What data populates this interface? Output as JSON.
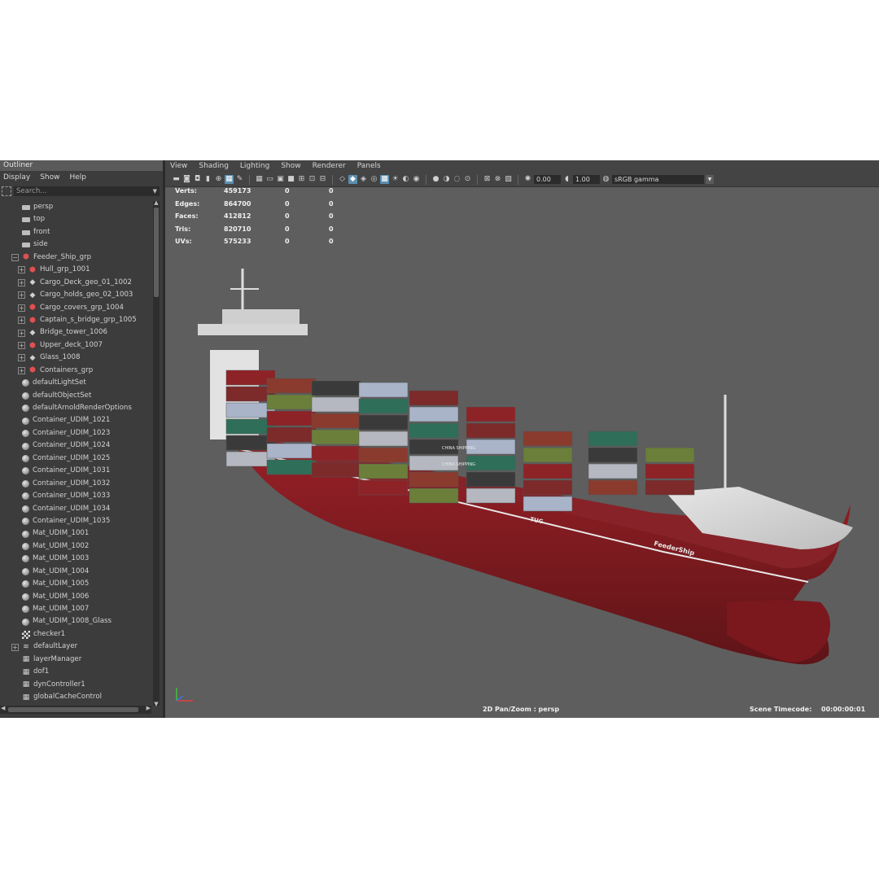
{
  "outliner": {
    "title": "Outliner",
    "menu": [
      "Display",
      "Show",
      "Help"
    ],
    "search_placeholder": "Search...",
    "items": [
      {
        "label": "persp",
        "icon": "camera-icon",
        "expand": false,
        "indent": 1
      },
      {
        "label": "top",
        "icon": "camera-icon",
        "expand": false,
        "indent": 1
      },
      {
        "label": "front",
        "icon": "camera-icon",
        "expand": false,
        "indent": 1
      },
      {
        "label": "side",
        "icon": "camera-icon",
        "expand": false,
        "indent": 1
      },
      {
        "label": "Feeder_Ship_grp",
        "icon": "group-icon",
        "expand": "minus",
        "indent": 0
      },
      {
        "label": "Hull_grp_1001",
        "icon": "group-icon",
        "expand": "plus",
        "indent": 1
      },
      {
        "label": "Cargo_Deck_geo_01_1002",
        "icon": "mesh-icon",
        "expand": "plus",
        "indent": 1
      },
      {
        "label": "Cargo_holds_geo_02_1003",
        "icon": "mesh-icon",
        "expand": "plus",
        "indent": 1
      },
      {
        "label": "Cargo_covers_grp_1004",
        "icon": "group-icon",
        "expand": "plus",
        "indent": 1
      },
      {
        "label": "Captain_s_bridge_grp_1005",
        "icon": "group-icon",
        "expand": "plus",
        "indent": 1
      },
      {
        "label": "Bridge_tower_1006",
        "icon": "mesh-icon",
        "expand": "plus",
        "indent": 1
      },
      {
        "label": "Upper_deck_1007",
        "icon": "group-icon",
        "expand": "plus",
        "indent": 1
      },
      {
        "label": "Glass_1008",
        "icon": "mesh-icon",
        "expand": "plus",
        "indent": 1
      },
      {
        "label": "Containers_grp",
        "icon": "group-icon",
        "expand": "plus",
        "indent": 1
      },
      {
        "label": "defaultLightSet",
        "icon": "set-icon",
        "expand": false,
        "indent": 0
      },
      {
        "label": "defaultObjectSet",
        "icon": "set-icon",
        "expand": false,
        "indent": 0
      },
      {
        "label": "defaultArnoldRenderOptions",
        "icon": "material-ball-icon",
        "expand": false,
        "indent": 0
      },
      {
        "label": "Container_UDIM_1021",
        "icon": "material-ball-icon",
        "expand": false,
        "indent": 0
      },
      {
        "label": "Container_UDIM_1023",
        "icon": "material-ball-icon",
        "expand": false,
        "indent": 0
      },
      {
        "label": "Container_UDIM_1024",
        "icon": "material-ball-icon",
        "expand": false,
        "indent": 0
      },
      {
        "label": "Container_UDIM_1025",
        "icon": "material-ball-icon",
        "expand": false,
        "indent": 0
      },
      {
        "label": "Container_UDIM_1031",
        "icon": "material-ball-icon",
        "expand": false,
        "indent": 0
      },
      {
        "label": "Container_UDIM_1032",
        "icon": "material-ball-icon",
        "expand": false,
        "indent": 0
      },
      {
        "label": "Container_UDIM_1033",
        "icon": "material-ball-icon",
        "expand": false,
        "indent": 0
      },
      {
        "label": "Container_UDIM_1034",
        "icon": "material-ball-icon",
        "expand": false,
        "indent": 0
      },
      {
        "label": "Container_UDIM_1035",
        "icon": "material-ball-icon",
        "expand": false,
        "indent": 0
      },
      {
        "label": "Mat_UDIM_1001",
        "icon": "material-ball-icon",
        "expand": false,
        "indent": 0
      },
      {
        "label": "Mat_UDIM_1002",
        "icon": "material-ball-icon",
        "expand": false,
        "indent": 0
      },
      {
        "label": "Mat_UDIM_1003",
        "icon": "material-ball-icon",
        "expand": false,
        "indent": 0
      },
      {
        "label": "Mat_UDIM_1004",
        "icon": "material-ball-icon",
        "expand": false,
        "indent": 0
      },
      {
        "label": "Mat_UDIM_1005",
        "icon": "material-ball-icon",
        "expand": false,
        "indent": 0
      },
      {
        "label": "Mat_UDIM_1006",
        "icon": "material-ball-icon",
        "expand": false,
        "indent": 0
      },
      {
        "label": "Mat_UDIM_1007",
        "icon": "material-ball-icon",
        "expand": false,
        "indent": 0
      },
      {
        "label": "Mat_UDIM_1008_Glass",
        "icon": "material-ball-icon",
        "expand": false,
        "indent": 0
      },
      {
        "label": "checker1",
        "icon": "checker-icon",
        "expand": false,
        "indent": 0
      },
      {
        "label": "defaultLayer",
        "icon": "layer-icon",
        "expand": "plus",
        "indent": 0
      },
      {
        "label": "layerManager",
        "icon": "node-icon",
        "expand": false,
        "indent": 0
      },
      {
        "label": "dof1",
        "icon": "node-icon",
        "expand": false,
        "indent": 0
      },
      {
        "label": "dynController1",
        "icon": "node-icon",
        "expand": false,
        "indent": 0
      },
      {
        "label": "globalCacheControl",
        "icon": "node-icon",
        "expand": false,
        "indent": 0
      }
    ]
  },
  "viewport": {
    "menu": [
      "View",
      "Shading",
      "Lighting",
      "Show",
      "Renderer",
      "Panels"
    ],
    "exposure": "0.00",
    "gamma": "1.00",
    "color_space": "sRGB gamma",
    "stats": [
      {
        "label": "Verts:",
        "v1": "459173",
        "v2": "0",
        "v3": "0"
      },
      {
        "label": "Edges:",
        "v1": "864700",
        "v2": "0",
        "v3": "0"
      },
      {
        "label": "Faces:",
        "v1": "412812",
        "v2": "0",
        "v3": "0"
      },
      {
        "label": "Tris:",
        "v1": "820710",
        "v2": "0",
        "v3": "0"
      },
      {
        "label": "UVs:",
        "v1": "575233",
        "v2": "0",
        "v3": "0"
      }
    ],
    "hud_camera": "2D Pan/Zoom : persp",
    "hud_timecode_label": "Scene Timecode:",
    "hud_timecode": "00:00:00:01",
    "ship_name": "FeederShip",
    "ship_logo": "TUG",
    "container_labels": [
      "CHINA SHIPPING",
      "CHINA SHIPPING"
    ],
    "colors": {
      "hull": "#8c1c22",
      "deck": "#d8d8d8",
      "background": "#5e5e5e",
      "accent": "#5b8fb0"
    }
  }
}
